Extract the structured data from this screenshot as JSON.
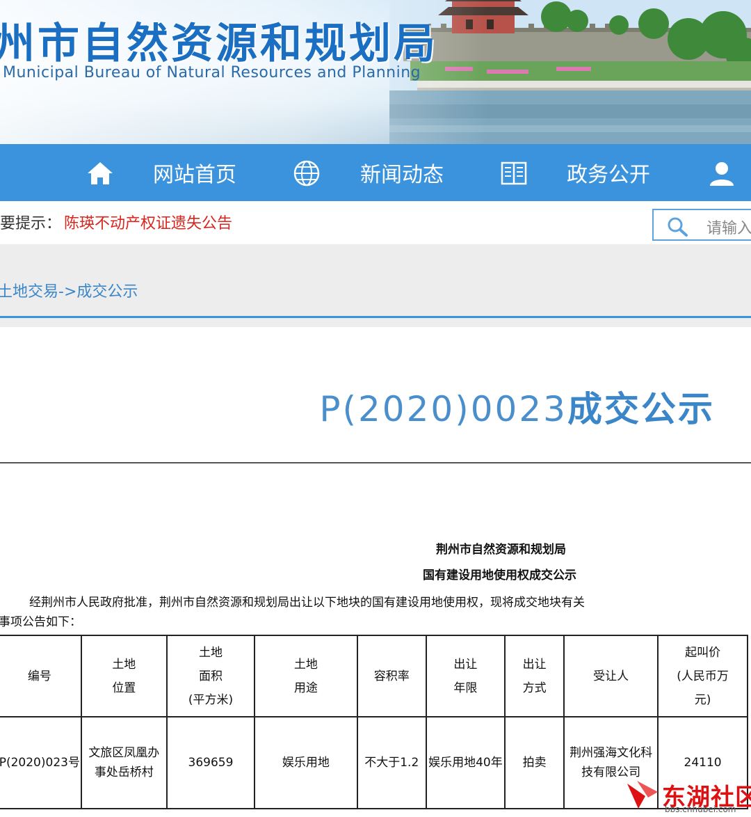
{
  "banner": {
    "title_cn": "州市自然资源和规划局",
    "title_en": "Municipal Bureau of Natural Resources and Planning"
  },
  "nav": {
    "items": [
      {
        "label": "网站首页",
        "icon": "home-icon"
      },
      {
        "label": "新闻动态",
        "icon": "globe-icon"
      },
      {
        "label": "政务公开",
        "icon": "book-icon"
      },
      {
        "label": "",
        "icon": "user-icon"
      }
    ]
  },
  "notice": {
    "label": "要提示：",
    "link": "陈瑛不动产权证遗失公告"
  },
  "search": {
    "placeholder": "请输入"
  },
  "breadcrumb": "土地交易->成交公示",
  "article": {
    "title_code": "P(2020)0023",
    "title_suffix": "成交公示"
  },
  "document": {
    "heading1": "荆州市自然资源和规划局",
    "heading2": "国有建设用地使用权成交公示",
    "paragraph_line1": "经荆州市人民政府批准，荆州市自然资源和规划局出让以下地块的国有建设用地使用权，现将成交地块有关",
    "paragraph_line2": "事项公告如下："
  },
  "table": {
    "headers": [
      "编号",
      "土地\n位置",
      "土地\n面积\n(平方米)",
      "土地\n用途",
      "容积率",
      "出让\n年限",
      "出让\n方式",
      "受让人",
      "起叫价\n(人民币万\n元)"
    ],
    "rows": [
      [
        "P(2020)023号",
        "文旅区凤凰办\n事处岳桥村",
        "369659",
        "娱乐用地",
        "不大于1.2",
        "娱乐用地40年",
        "拍卖",
        "荆州强海文化科\n技有限公司",
        "24110"
      ]
    ]
  },
  "watermark": {
    "text": "东湖社区",
    "url": "bbs.cnhubei.com"
  },
  "colors": {
    "nav_blue": "#3c93dd",
    "link_blue": "#3a86c8",
    "notice_red": "#d7261e",
    "watermark_red": "#dd1111"
  }
}
